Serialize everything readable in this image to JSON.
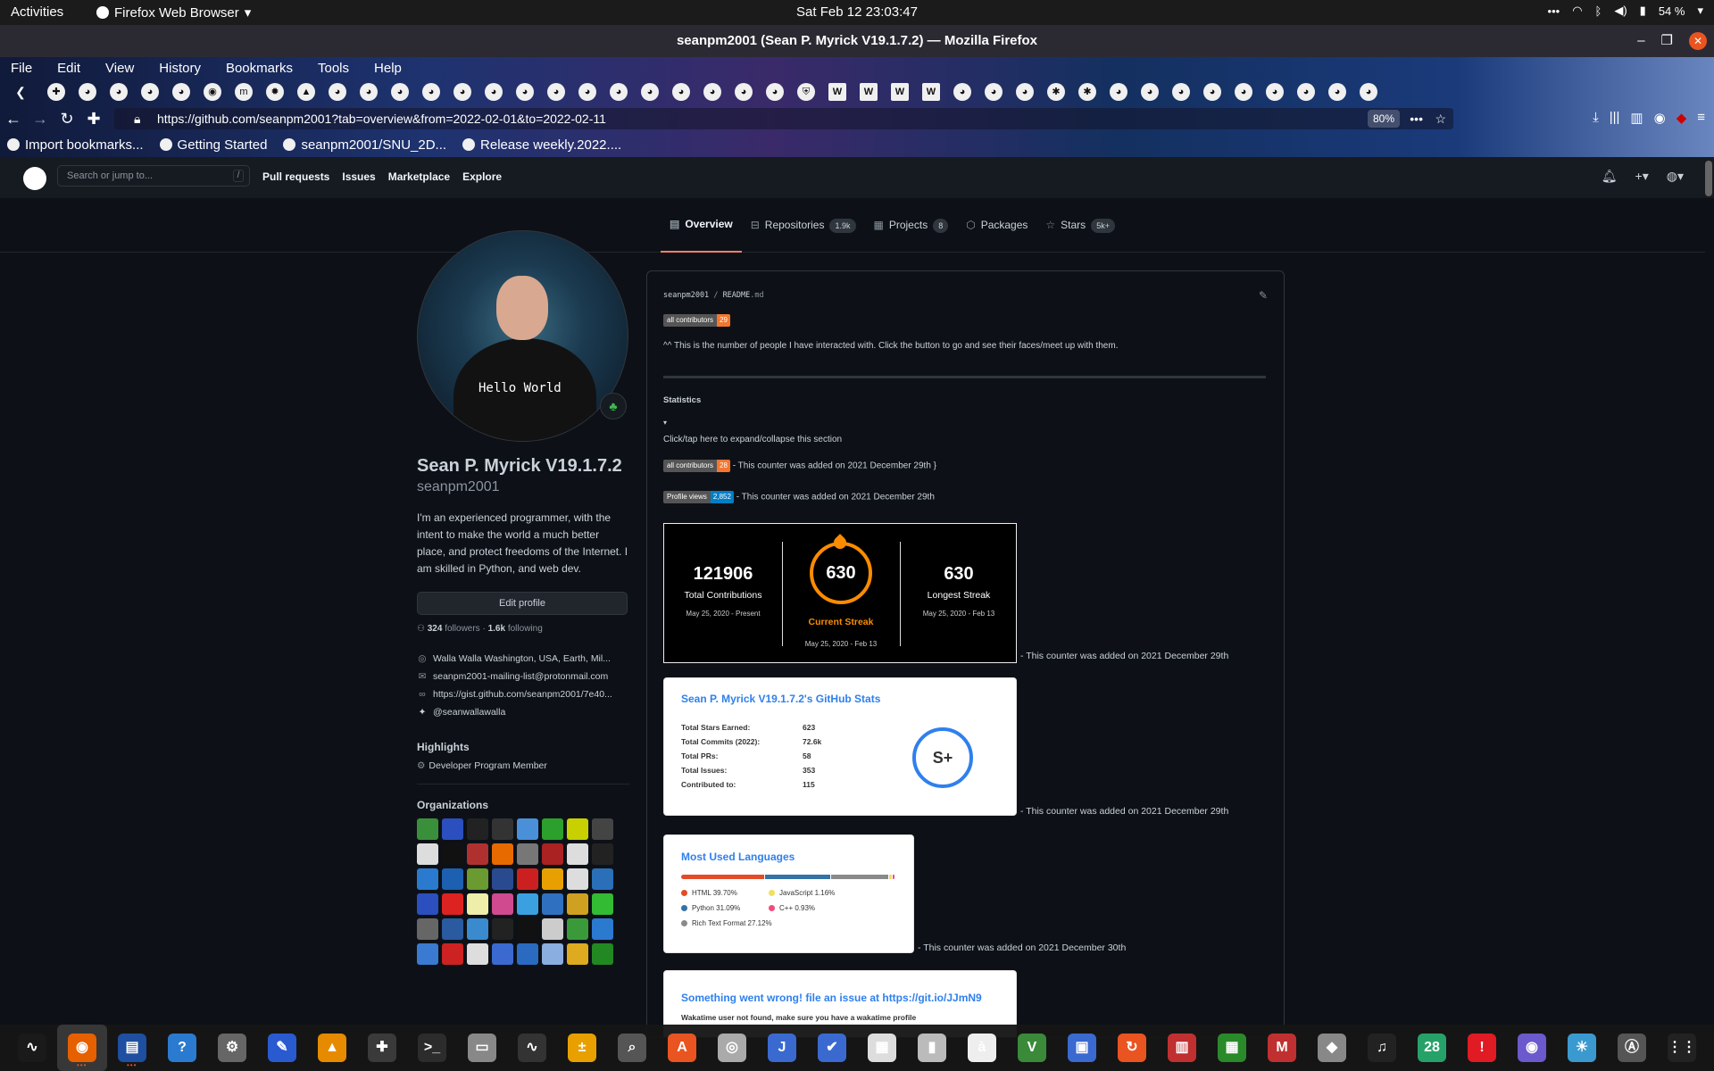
{
  "system": {
    "activities": "Activities",
    "app_name": "Firefox Web Browser",
    "clock": "Sat Feb 12  23:03:47",
    "battery": "54 %"
  },
  "window": {
    "title": "seanpm2001 (Sean P. Myrick V19.1.7.2) — Mozilla Firefox"
  },
  "firefox": {
    "menu": [
      "File",
      "Edit",
      "View",
      "History",
      "Bookmarks",
      "Tools",
      "Help"
    ],
    "tab_icons": [
      "puzzle",
      "github",
      "github",
      "github",
      "github",
      "firefox",
      "m",
      "gear",
      "brave",
      "github",
      "github",
      "github",
      "github",
      "github",
      "github",
      "github",
      "github",
      "github",
      "github",
      "github",
      "github",
      "github",
      "github",
      "github",
      "shield",
      "W",
      "W",
      "W",
      "W",
      "github",
      "github",
      "github",
      "bug",
      "bug",
      "github",
      "github",
      "github",
      "github",
      "github",
      "github",
      "github",
      "github",
      "github"
    ],
    "url": "https://github.com/seanpm2001?tab=overview&from=2022-02-01&to=2022-02-11",
    "zoom": "80%",
    "bookmarks": [
      "Import bookmarks...",
      "Getting Started",
      "seanpm2001/SNU_2D...",
      "Release weekly.2022...."
    ]
  },
  "github": {
    "search_placeholder": "Search or jump to...",
    "search_key": "/",
    "nav": [
      "Pull requests",
      "Issues",
      "Marketplace",
      "Explore"
    ],
    "tabs": [
      {
        "label": "Overview",
        "count": ""
      },
      {
        "label": "Repositories",
        "count": "1.9k"
      },
      {
        "label": "Projects",
        "count": "8"
      },
      {
        "label": "Packages",
        "count": ""
      },
      {
        "label": "Stars",
        "count": "5k+"
      }
    ],
    "profile": {
      "name": "Sean P. Myrick V19.1.7.2",
      "login": "seanpm2001",
      "shirt_text": "Hello World",
      "bio": "I'm an experienced programmer, with the intent to make the world a much better place, and protect freedoms of the Internet. I am skilled in Python, and web dev.",
      "edit_button": "Edit profile",
      "followers_count": "324",
      "followers_label": "followers",
      "separator": "·",
      "following_count": "1.6k",
      "following_label": "following",
      "location": "Walla Walla Washington, USA, Earth, Mil...",
      "email": "seanpm2001-mailing-list@protonmail.com",
      "website": "https://gist.github.com/seanpm2001/7e40...",
      "twitter": "@seanwallawalla",
      "highlights_heading": "Highlights",
      "highlight": "Developer Program Member",
      "organizations_heading": "Organizations",
      "org_colors": [
        "#3a8f3a",
        "#2b4fbf",
        "#222",
        "#333",
        "#4a90d9",
        "#2ca02c",
        "#c8d000",
        "#444",
        "#ddd",
        "#111",
        "#b03030",
        "#e66a00",
        "#777",
        "#aa2222",
        "#ddd",
        "#222",
        "#2a7ad0",
        "#1d5fb0",
        "#6a9a30",
        "#2a4a90",
        "#cc2020",
        "#e8a000",
        "#ddd",
        "#2a6fb8",
        "#2b4fbf",
        "#dd2222",
        "#eeeeaa",
        "#d04a90",
        "#3aa0e0",
        "#3070c0",
        "#d0a020",
        "#33bb33",
        "#666",
        "#2a5aa0",
        "#3a8ad0",
        "#222",
        "#111",
        "#ccc",
        "#3a9a3a",
        "#2a7ad0",
        "#3a7ad0",
        "#cc2222",
        "#ddd",
        "#3a6ad0",
        "#2a6ac0",
        "#8aaee0",
        "#ddaa20",
        "#228822"
      ]
    },
    "readme": {
      "owner": "seanpm2001",
      "sep": "/",
      "file": "README",
      "ext": ".md",
      "contributors_label": "all contributors",
      "contributors_count_1": "29",
      "intro": "^^ This is the number of people I have interacted with. Click the button to go and see their faces/meet up with them.",
      "statistics": "Statistics",
      "triangle": "▾",
      "expand": "Click/tap here to expand/collapse this section",
      "contributors_count_2": "28",
      "note_contrib": "- This counter was added on 2021 December 29th",
      "views_label": "Profile views",
      "views_count": "2,852",
      "note_views": "- This counter was added on 2021 December 29th",
      "note_streak": "- This counter was added on 2021 December 29th",
      "note_stats": "- This counter was added on 2021 December 29th",
      "note_langs": "- This counter was added on 2021 December 30th"
    },
    "streak": {
      "total": "121906",
      "total_label": "Total Contributions",
      "total_range": "May 25, 2020 - Present",
      "current": "630",
      "current_label": "Current Streak",
      "current_range": "May 25, 2020 - Feb 13",
      "longest": "630",
      "longest_label": "Longest Streak",
      "longest_range": "May 25, 2020 - Feb 13"
    },
    "stats": {
      "title": "Sean P. Myrick V19.1.7.2's GitHub Stats",
      "rows": [
        {
          "label": "Total Stars Earned:",
          "value": "623"
        },
        {
          "label": "Total Commits (2022):",
          "value": "72.6k"
        },
        {
          "label": "Total PRs:",
          "value": "58"
        },
        {
          "label": "Total Issues:",
          "value": "353"
        },
        {
          "label": "Contributed to:",
          "value": "115"
        }
      ],
      "grade": "S+"
    },
    "languages": {
      "title": "Most Used Languages",
      "items": [
        {
          "name": "HTML 39.70%",
          "pct": 39.7,
          "color": "#e34c26"
        },
        {
          "name": "Python 31.09%",
          "pct": 31.09,
          "color": "#3572A5"
        },
        {
          "name": "Rich Text Format 27.12%",
          "pct": 27.12,
          "color": "#8a8a8a"
        },
        {
          "name": "JavaScript 1.16%",
          "pct": 1.16,
          "color": "#f1e05a"
        },
        {
          "name": "C++ 0.93%",
          "pct": 0.93,
          "color": "#f34b7d"
        }
      ]
    },
    "wakatime": {
      "title": "Something went wrong! file an issue at https://git.io/JJmN9",
      "message": "Wakatime user not found, make sure you have a wakatime profile"
    }
  },
  "dock": {
    "items": [
      "system-monitor",
      "firefox",
      "text-editor",
      "help",
      "settings",
      "notes",
      "vlc",
      "extensions",
      "terminal",
      "files",
      "monitor",
      "calculator",
      "search",
      "software",
      "chromium",
      "journal",
      "todo",
      "papers",
      "archive",
      "text",
      "vim",
      "screen",
      "update",
      "document",
      "spreadsheet",
      "mario",
      "tux",
      "music",
      "calendar",
      "alert",
      "camera",
      "weather",
      "app-store",
      "apps-grid"
    ],
    "calendar_day": "28"
  },
  "colors": {
    "accent": "#f78166",
    "link": "#2f80ed",
    "streak_orange": "#fb8c00"
  }
}
